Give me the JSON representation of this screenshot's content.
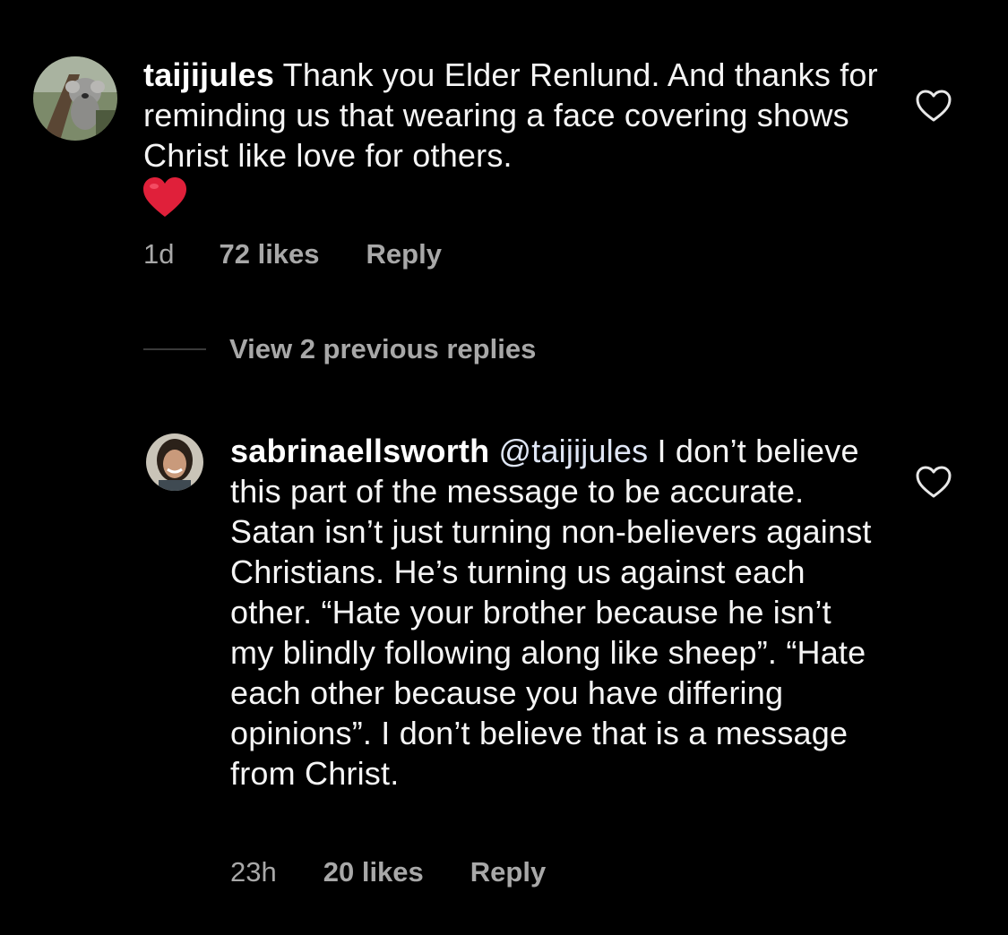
{
  "comments": [
    {
      "username": "taijijules",
      "mention": "",
      "text": "Thank you Elder Renlund. And thanks for reminding us that wearing a face covering shows Christ like love for others.",
      "emoji": "red-heart",
      "time": "1d",
      "likes": "72 likes",
      "reply_label": "Reply",
      "like_icon": "heart-outline-icon"
    },
    {
      "username": "sabrinaellsworth",
      "mention": "@taijijules",
      "text": "I don’t believe this part of the message to be accurate. Satan isn’t just turning non-believers against Christians. He’s turning us against each other. “Hate your brother because he isn’t my blindly following along like sheep”. “Hate each other because you have differing opinions”. I don’t believe that is a message from Christ.",
      "time": "23h",
      "likes": "20 likes",
      "reply_label": "Reply",
      "like_icon": "heart-outline-icon"
    }
  ],
  "view_replies": {
    "label": "View 2 previous replies"
  },
  "colors": {
    "background": "#000000",
    "text": "#f5f5f5",
    "secondary": "#a8a8a8",
    "heart": "#e0203a"
  }
}
